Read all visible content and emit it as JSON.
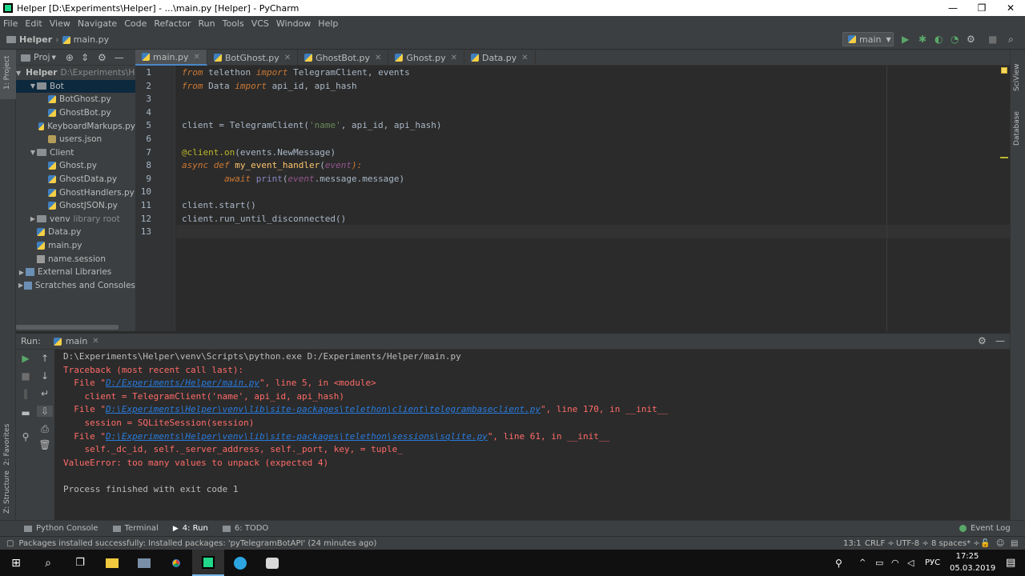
{
  "window": {
    "title": "Helper [D:\\Experiments\\Helper] - ...\\main.py [Helper] - PyCharm",
    "minimize": "—",
    "maximize": "❐",
    "close": "✕"
  },
  "menu": [
    "File",
    "Edit",
    "View",
    "Navigate",
    "Code",
    "Refactor",
    "Run",
    "Tools",
    "VCS",
    "Window",
    "Help"
  ],
  "navbar": {
    "project": "Helper",
    "file": "main.py",
    "run_config": "main"
  },
  "left_strip": {
    "project_label": "1: Project",
    "favorites_label": "2: Favorites",
    "structure_label": "Z: Structure"
  },
  "right_strip": {
    "sciview_label": "SciView",
    "database_label": "Database"
  },
  "project_panel": {
    "header": "Proj",
    "tree": [
      {
        "label": "Helper",
        "extra": "D:\\Experiments\\He",
        "type": "folder",
        "depth": 0,
        "expanded": true,
        "bold": true
      },
      {
        "label": "Bot",
        "type": "folder",
        "depth": 1,
        "expanded": true,
        "selected": true
      },
      {
        "label": "BotGhost.py",
        "type": "py",
        "depth": 2
      },
      {
        "label": "GhostBot.py",
        "type": "py",
        "depth": 2
      },
      {
        "label": "KeyboardMarkups.py",
        "type": "py",
        "depth": 2
      },
      {
        "label": "users.json",
        "type": "json",
        "depth": 2
      },
      {
        "label": "Client",
        "type": "folder",
        "depth": 1,
        "expanded": true
      },
      {
        "label": "Ghost.py",
        "type": "py",
        "depth": 2
      },
      {
        "label": "GhostData.py",
        "type": "py",
        "depth": 2
      },
      {
        "label": "GhostHandlers.py",
        "type": "py",
        "depth": 2
      },
      {
        "label": "GhostJSON.py",
        "type": "py",
        "depth": 2
      },
      {
        "label": "venv",
        "extra": "library root",
        "type": "folder",
        "depth": 1,
        "expanded": false
      },
      {
        "label": "Data.py",
        "type": "py",
        "depth": 1
      },
      {
        "label": "main.py",
        "type": "py",
        "depth": 1
      },
      {
        "label": "name.session",
        "type": "session",
        "depth": 1
      },
      {
        "label": "External Libraries",
        "type": "lib",
        "depth": 0,
        "expanded": false
      },
      {
        "label": "Scratches and Consoles",
        "type": "lib",
        "depth": 0,
        "expanded": false
      }
    ]
  },
  "tabs": [
    {
      "label": "main.py",
      "active": true
    },
    {
      "label": "BotGhost.py",
      "active": false
    },
    {
      "label": "GhostBot.py",
      "active": false
    },
    {
      "label": "Ghost.py",
      "active": false
    },
    {
      "label": "Data.py",
      "active": false
    }
  ],
  "code_lines": [
    "1",
    "2",
    "3",
    "4",
    "5",
    "6",
    "7",
    "8",
    "9",
    "10",
    "11",
    "12",
    "13"
  ],
  "code_text": {
    "l1": [
      "from",
      " telethon ",
      "import",
      " TelegramClient, events"
    ],
    "l2": [
      "from",
      " Data ",
      "import",
      " api_id, api_hash"
    ],
    "l5": [
      "client = TelegramClient(",
      "'name'",
      ", api_id, api_hash)"
    ],
    "l7": [
      "@client.on",
      "(events.NewMessage)"
    ],
    "l8": [
      "async def ",
      "my_event_handler",
      "(",
      "event",
      "):"
    ],
    "l9": [
      "        await ",
      "print",
      "(",
      "event",
      ".message.message)"
    ],
    "l11": "client.start()",
    "l12": "client.run_until_disconnected()"
  },
  "run_panel": {
    "label": "Run:",
    "tab": "main",
    "console": {
      "cmd": "D:\\Experiments\\Helper\\venv\\Scripts\\python.exe D:/Experiments/Helper/main.py",
      "tb": "Traceback (most recent call last):",
      "f1_pre": "  File \"",
      "f1_link": "D:/Experiments/Helper/main.py",
      "f1_post": "\", line 5, in <module>",
      "f1_code": "    client = TelegramClient('name', api_id, api_hash)",
      "f2_pre": "  File \"",
      "f2_link": "D:\\Experiments\\Helper\\venv\\lib\\site-packages\\telethon\\client\\telegrambaseclient.py",
      "f2_post": "\", line 170, in __init__",
      "f2_code": "    session = SQLiteSession(session)",
      "f3_pre": "  File \"",
      "f3_link": "D:\\Experiments\\Helper\\venv\\lib\\site-packages\\telethon\\sessions\\sqlite.py",
      "f3_post": "\", line 61, in __init__",
      "f3_code": "    self._dc_id, self._server_address, self._port, key, = tuple_",
      "error": "ValueError: too many values to unpack (expected 4)",
      "exit": "Process finished with exit code 1"
    }
  },
  "bottom_tools": [
    {
      "label": "Python Console",
      "active": false
    },
    {
      "label": "Terminal",
      "active": false
    },
    {
      "label": "4: Run",
      "active": true
    },
    {
      "label": "6: TODO",
      "active": false
    }
  ],
  "event_log": "Event Log",
  "status": {
    "message": "Packages installed successfully: Installed packages: 'pyTelegramBotAPI' (24 minutes ago)",
    "position": "13:1",
    "line_sep": "CRLF ÷",
    "encoding": "UTF-8 ÷",
    "indent": "8 spaces* ÷"
  },
  "taskbar": {
    "lang": "РУС",
    "time": "17:25",
    "date": "05.03.2019"
  },
  "colors": {
    "editor_bg": "#2b2b2b",
    "panel_bg": "#3c3f41",
    "keyword": "#cc7832",
    "string": "#6a8759",
    "error": "#ff6b68",
    "link": "#287bde",
    "run_green": "#59a869"
  }
}
